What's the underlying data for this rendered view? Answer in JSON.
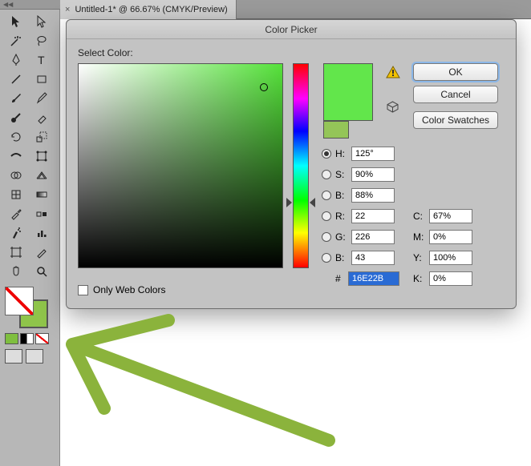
{
  "tab": {
    "title": "Untitled-1* @ 66.67% (CMYK/Preview)"
  },
  "dialog": {
    "title": "Color Picker",
    "select_label": "Select Color:",
    "ok": "OK",
    "cancel": "Cancel",
    "swatches": "Color Swatches",
    "web_only": "Only Web Colors"
  },
  "hsb": {
    "h_label": "H:",
    "h_value": "125°",
    "s_label": "S:",
    "s_value": "90%",
    "b_label": "B:",
    "b_value": "88%"
  },
  "rgb": {
    "r_label": "R:",
    "r_value": "22",
    "g_label": "G:",
    "g_value": "226",
    "b_label": "B:",
    "b_value": "43"
  },
  "hex": {
    "hash": "#",
    "value": "16E22B"
  },
  "cmyk": {
    "c_label": "C:",
    "c_value": "67%",
    "m_label": "M:",
    "m_value": "0%",
    "y_label": "Y:",
    "y_value": "100%",
    "k_label": "K:",
    "k_value": "0%"
  },
  "colors": {
    "new": "#62e64b",
    "old": "#94c558",
    "fill": "#ffffff",
    "stroke": "#8fc44a"
  },
  "tools": [
    "selection",
    "direct-selection",
    "magic-wand",
    "lasso",
    "pen",
    "type",
    "line",
    "rectangle",
    "brush",
    "pencil",
    "blob",
    "eraser",
    "rotate",
    "scale",
    "width",
    "reshape",
    "shape-builder",
    "perspective",
    "mesh",
    "gradient",
    "eyedropper",
    "blend",
    "symbol",
    "graph",
    "artboard",
    "slice",
    "hand",
    "zoom"
  ]
}
